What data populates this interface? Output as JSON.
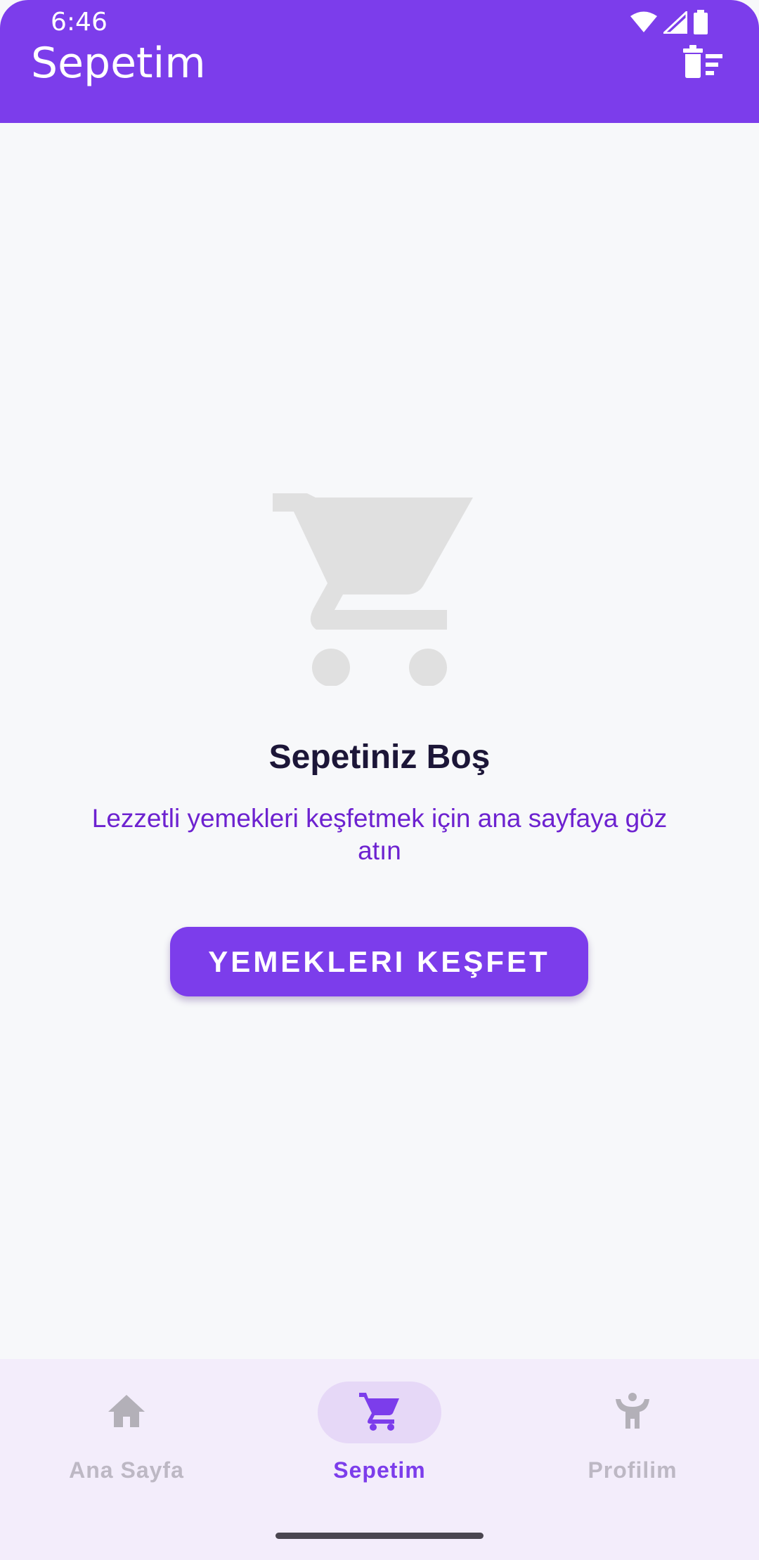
{
  "status_bar": {
    "time": "6:46"
  },
  "app_bar": {
    "title": "Sepetim",
    "background": "#7c3deb",
    "action_icon": "clear-all-trash-icon"
  },
  "empty_state": {
    "icon": "shopping-cart-icon",
    "title": "Sepetiniz Boş",
    "subtitle": "Lezzetli yemekleri keşfetmek için ana sayfaya göz atın",
    "button_label": "YEMEKLERI KEŞFET"
  },
  "bottom_nav": {
    "items": [
      {
        "label": "Ana Sayfa",
        "icon": "home-icon",
        "active": false
      },
      {
        "label": "Sepetim",
        "icon": "shopping-cart-icon",
        "active": true
      },
      {
        "label": "Profilim",
        "icon": "person-icon",
        "active": false
      }
    ]
  },
  "colors": {
    "accent": "#7c3deb",
    "title_text": "#1c1638",
    "subtitle_text": "#6d22d0",
    "inactive_nav": "#bdb8c4",
    "nav_background": "#f3edfb"
  }
}
